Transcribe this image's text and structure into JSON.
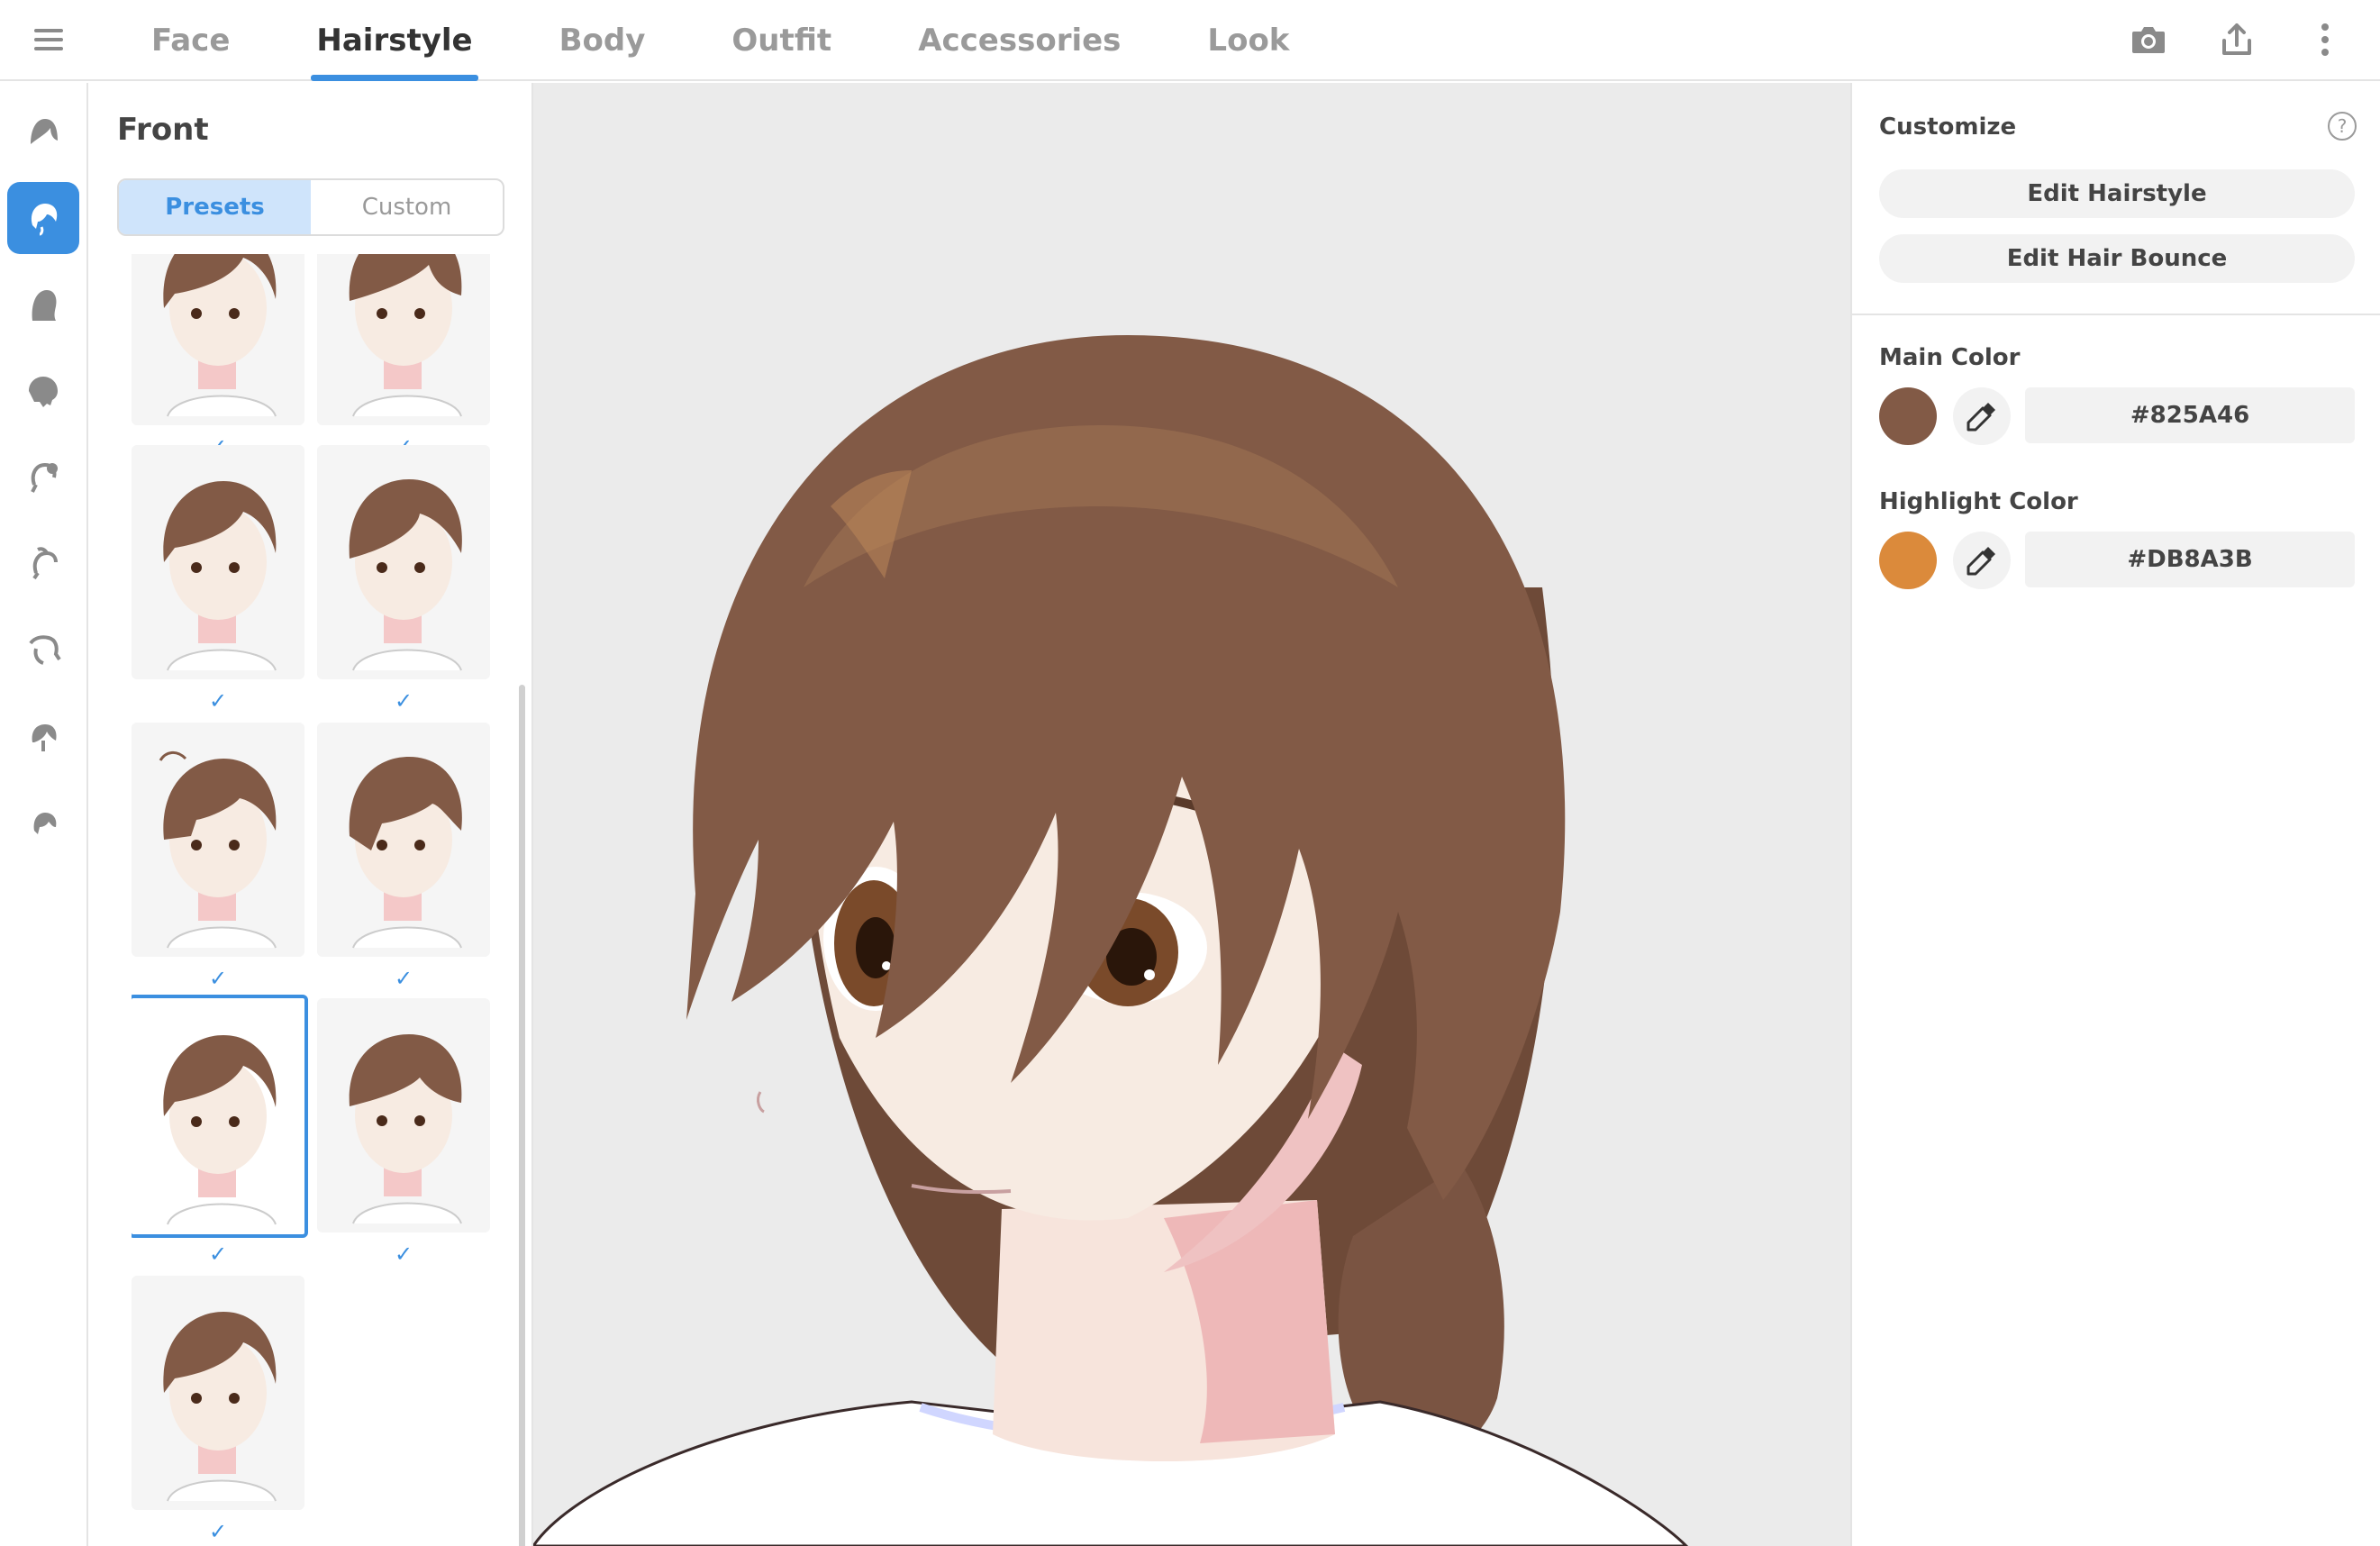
{
  "tabs": [
    {
      "label": "Face"
    },
    {
      "label": "Hairstyle"
    },
    {
      "label": "Body"
    },
    {
      "label": "Outfit"
    },
    {
      "label": "Accessories"
    },
    {
      "label": "Look"
    }
  ],
  "active_tab": "Hairstyle",
  "top_icons": [
    "camera-icon",
    "share-icon",
    "more-vertical-icon"
  ],
  "rail": {
    "items": [
      "hair-base-icon",
      "hair-front-icon",
      "hair-side-icon",
      "hair-back-icon",
      "hair-bun-icon",
      "hair-ahoge-icon",
      "hair-tail-icon",
      "hair-extra-icon",
      "hair-accent-icon"
    ],
    "active_index": 1
  },
  "panel": {
    "title": "Front",
    "segment": {
      "presets": "Presets",
      "custom": "Custom",
      "active": "Presets"
    },
    "presets_checkmark": "✓",
    "selected_preset_index": 8,
    "preset_count": 11
  },
  "right": {
    "title": "Customize",
    "edit_hairstyle": "Edit Hairstyle",
    "edit_hair_bounce": "Edit Hair Bounce",
    "main_color": {
      "label": "Main Color",
      "hex": "#825A46",
      "swatch": "#825A46"
    },
    "highlight_color": {
      "label": "Highlight Color",
      "hex": "#DB8A3B",
      "swatch": "#DB8A3B"
    }
  },
  "colors": {
    "accent": "#3b8fe0",
    "hair": "#825A46",
    "skin": "#f5e6dc",
    "shirt": "#ffffff"
  }
}
